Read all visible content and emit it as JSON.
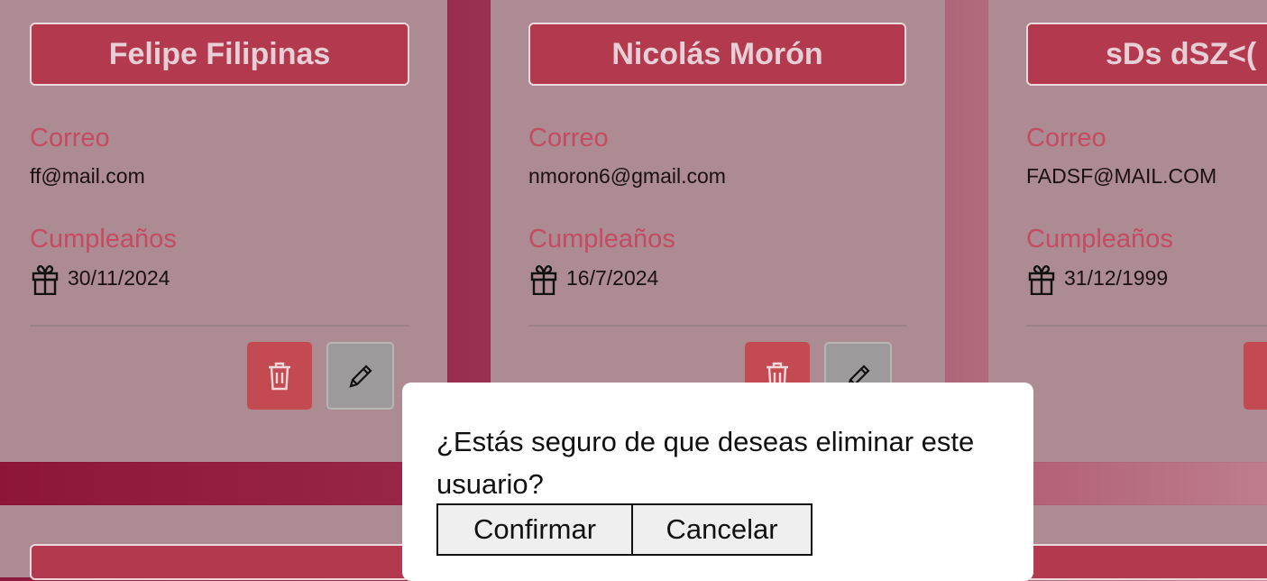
{
  "labels": {
    "email": "Correo",
    "birthday": "Cumpleaños"
  },
  "users": [
    {
      "name": "Felipe Filipinas",
      "email": "ff@mail.com",
      "birthday": "30/11/2024"
    },
    {
      "name": "Nicolás Morón",
      "email": "nmoron6@gmail.com",
      "birthday": "16/7/2024"
    },
    {
      "name": "sDs dSZ<(",
      "email": "FADSF@MAIL.COM",
      "birthday": "31/12/1999"
    }
  ],
  "icons": {
    "gift": "gift-icon",
    "delete": "trash-icon",
    "edit": "pencil-icon"
  },
  "colors": {
    "card_bg": "#ad8b92",
    "name_bg": "#b2394e",
    "label": "#c64a62",
    "delete_button": "#c44a52",
    "edit_button": "#9d9a9c"
  },
  "dialog": {
    "message": "¿Estás seguro de que deseas eliminar este usuario?",
    "confirm_label": "Confirmar",
    "cancel_label": "Cancelar"
  }
}
